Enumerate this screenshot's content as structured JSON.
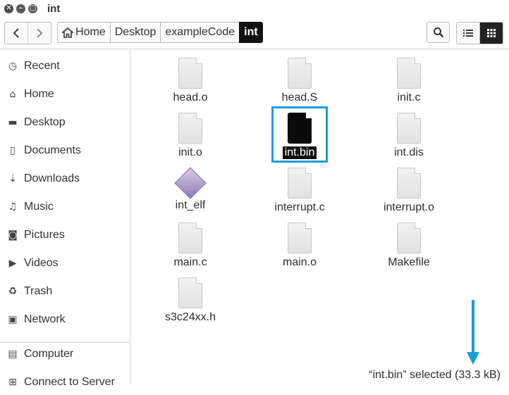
{
  "window": {
    "title": "int"
  },
  "toolbar": {
    "back_icon": "chevron-left",
    "forward_icon": "chevron-right",
    "breadcrumbs": [
      "Home",
      "Desktop",
      "exampleCode",
      "int"
    ]
  },
  "sidebar": {
    "items": [
      {
        "label": "Recent",
        "icon": "clock-icon"
      },
      {
        "label": "Home",
        "icon": "home-icon"
      },
      {
        "label": "Desktop",
        "icon": "folder-icon"
      },
      {
        "label": "Documents",
        "icon": "document-icon"
      },
      {
        "label": "Downloads",
        "icon": "download-icon"
      },
      {
        "label": "Music",
        "icon": "music-icon"
      },
      {
        "label": "Pictures",
        "icon": "camera-icon"
      },
      {
        "label": "Videos",
        "icon": "video-icon"
      },
      {
        "label": "Trash",
        "icon": "trash-icon"
      },
      {
        "label": "Network",
        "icon": "network-icon"
      },
      {
        "label": "Computer",
        "icon": "computer-icon"
      },
      {
        "label": "Connect to Server",
        "icon": "server-icon"
      }
    ]
  },
  "files": [
    {
      "name": "head.o",
      "icon": "generic"
    },
    {
      "name": "head.S",
      "icon": "generic"
    },
    {
      "name": "init.c",
      "icon": "generic"
    },
    {
      "name": "init.o",
      "icon": "generic"
    },
    {
      "name": "int.bin",
      "icon": "binary",
      "selected": true
    },
    {
      "name": "int.dis",
      "icon": "generic"
    },
    {
      "name": "int_elf",
      "icon": "executable"
    },
    {
      "name": "interrupt.c",
      "icon": "generic"
    },
    {
      "name": "interrupt.o",
      "icon": "generic"
    },
    {
      "name": "main.c",
      "icon": "generic"
    },
    {
      "name": "main.o",
      "icon": "generic"
    },
    {
      "name": "Makefile",
      "icon": "generic"
    },
    {
      "name": "s3c24xx.h",
      "icon": "generic"
    }
  ],
  "status": {
    "text": "“int.bin” selected  (33.3 kB)"
  },
  "colors": {
    "highlight": "#1a9ed9",
    "selection": "#111111"
  }
}
